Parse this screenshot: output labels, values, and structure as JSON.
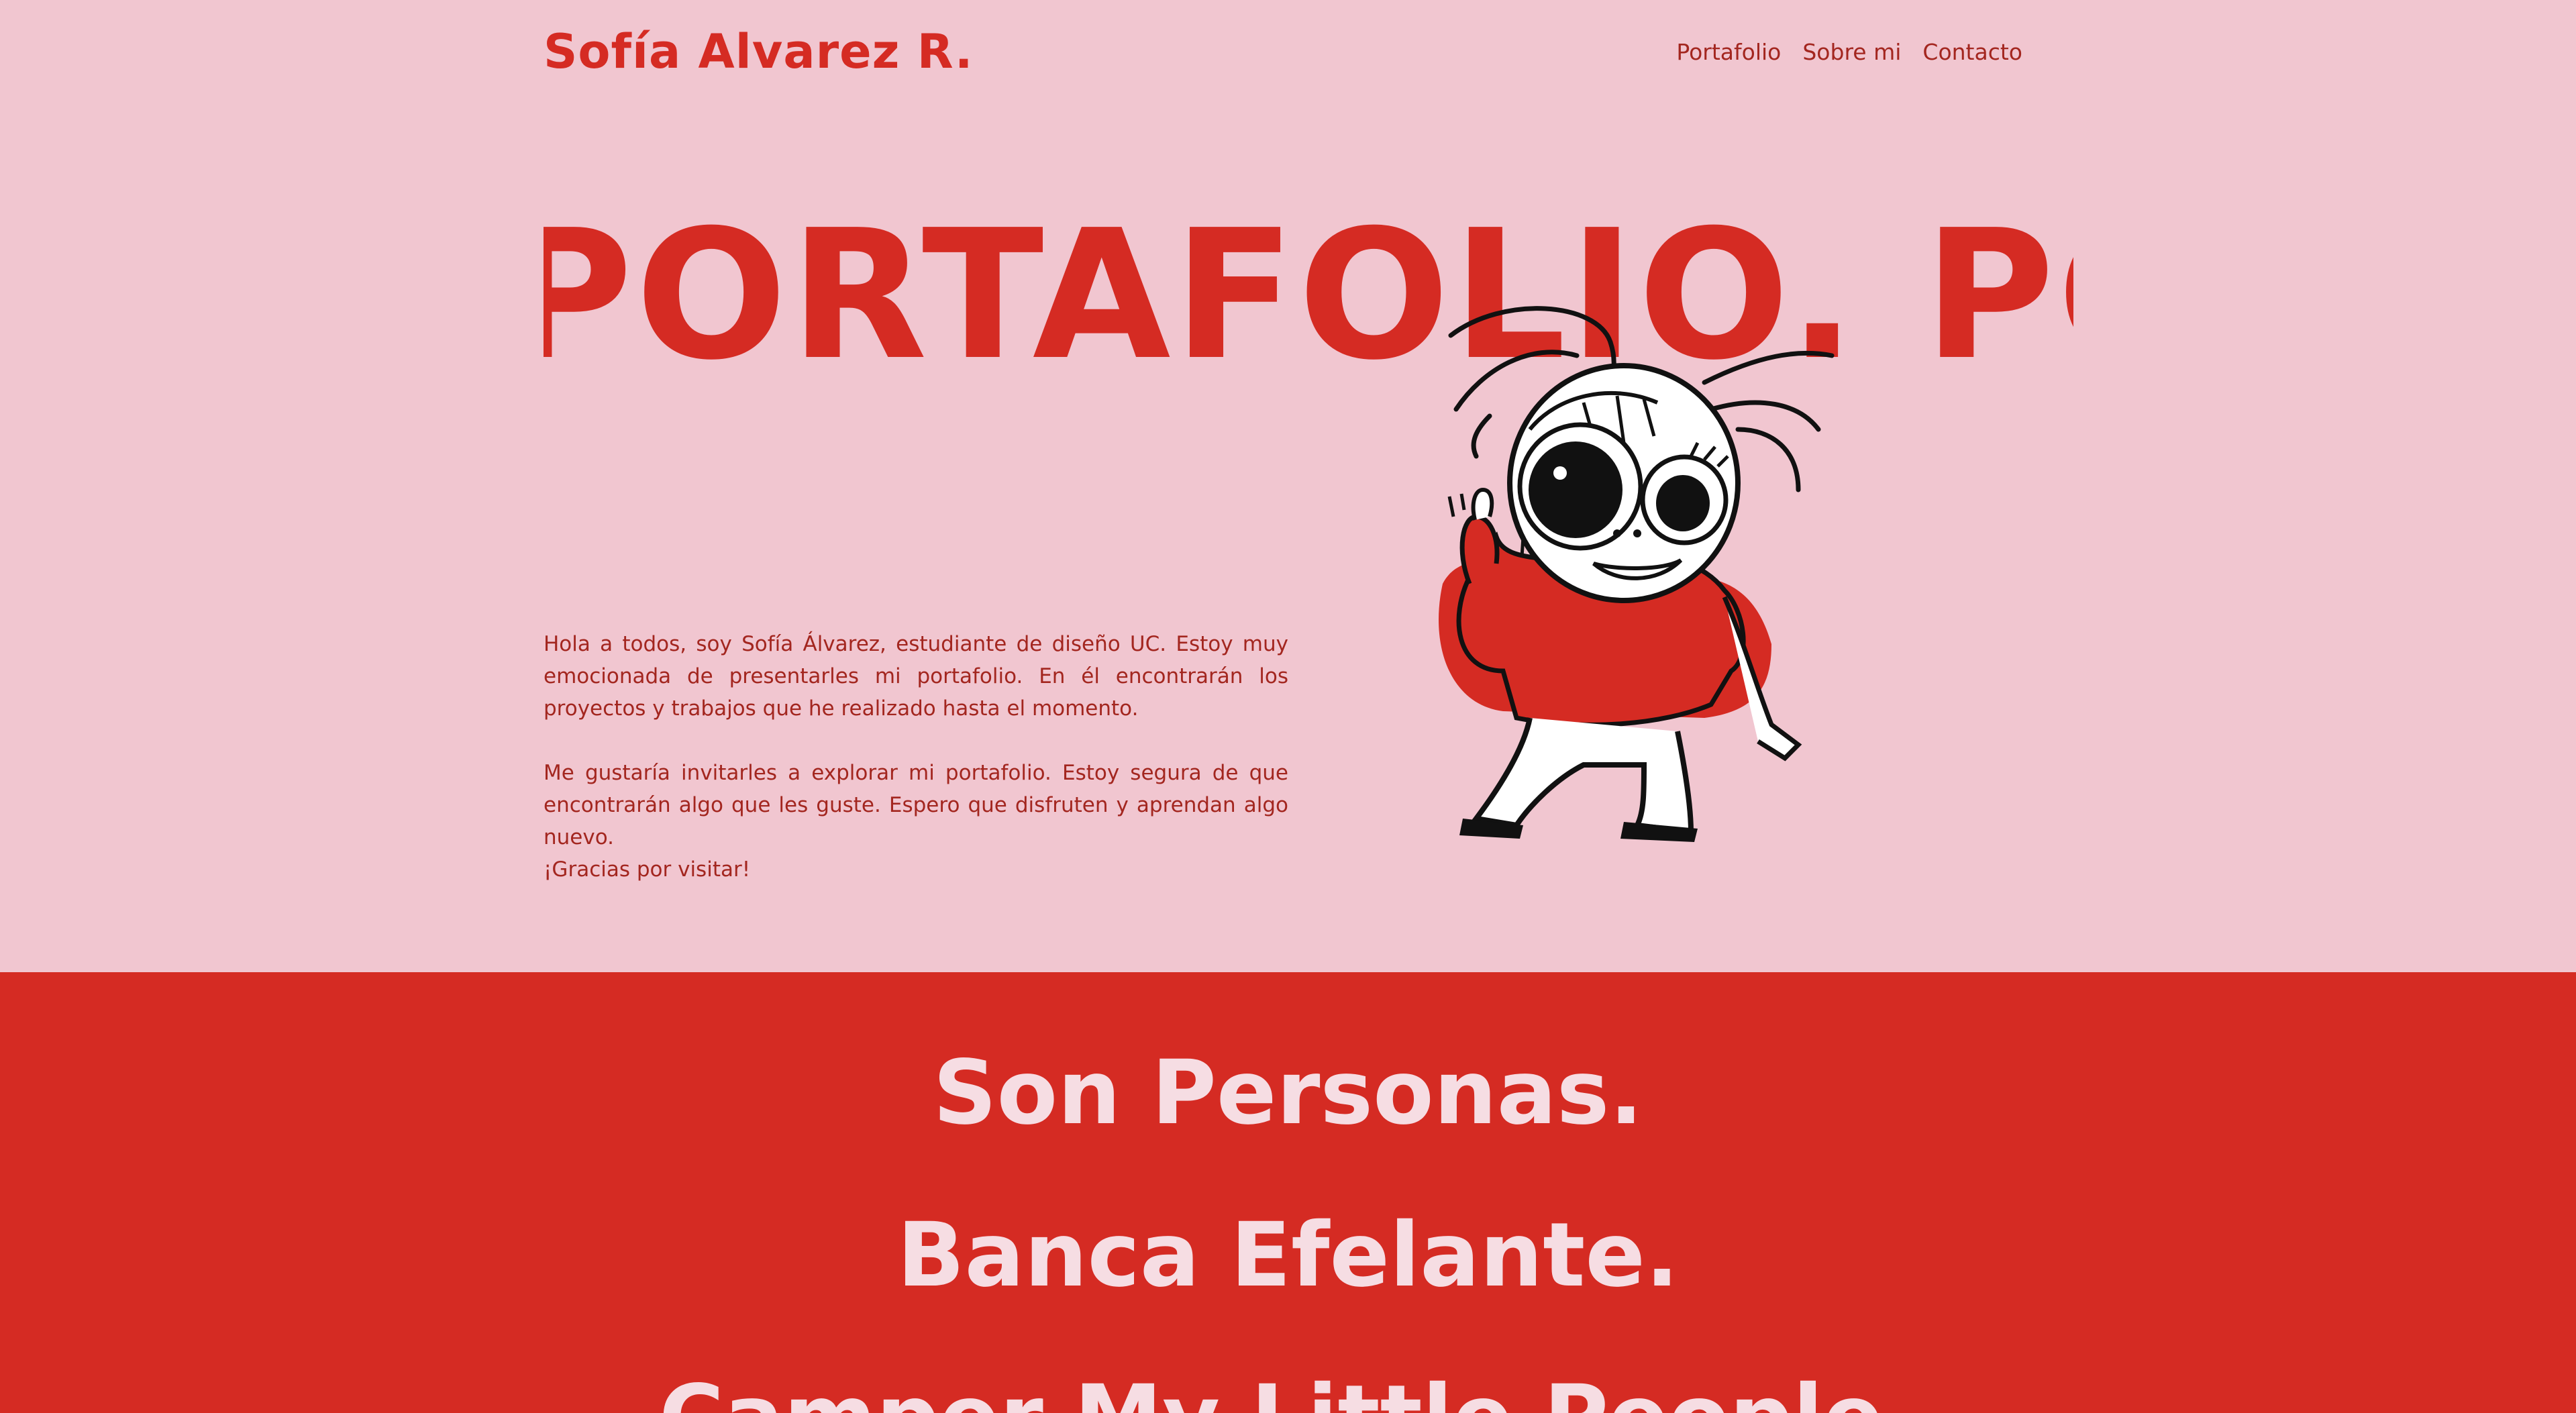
{
  "header": {
    "brand": "Sofía Alvarez R.",
    "nav": [
      "Portafolio",
      "Sobre mi",
      "Contacto"
    ]
  },
  "hero": {
    "marquee_text": "PORTAFOLIO.  PORTAFOLIO.",
    "intro": {
      "p1": "Hola a todos, soy Sofía Álvarez, estudiante de diseño UC. Estoy muy emocionada de presentarles mi portafolio. En él encontrarán los proyectos y trabajos que he realizado hasta el momento.",
      "p2": "Me gustaría invitarles a explorar mi portafolio. Estoy segura de que encontrarán algo que les guste. Espero que disfruten y aprendan algo nuevo.",
      "p3": "¡Gracias por visitar!"
    },
    "illustration_icon": "girl-character-thumbs-up-illustration"
  },
  "projects": {
    "items": [
      "Son Personas.",
      "Banca Efelante.",
      "Camper My Little People."
    ]
  },
  "colors": {
    "background": "#f1c6d0",
    "accent": "#d52b23",
    "text_dark_red": "#a3261f",
    "project_text": "#f6dde3"
  }
}
